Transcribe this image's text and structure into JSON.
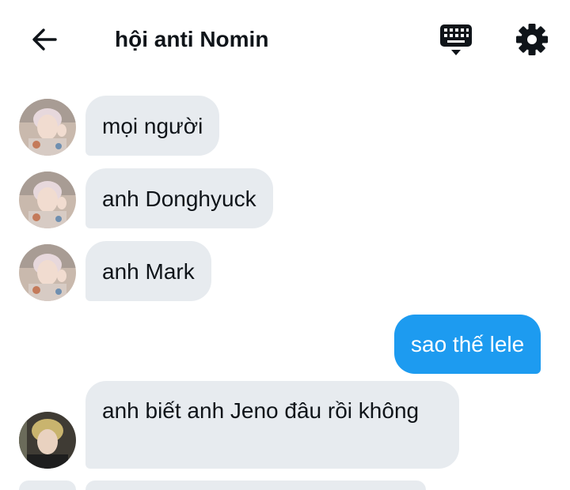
{
  "header": {
    "title": "hội anti Nomin",
    "back_icon": "arrow-left-icon",
    "keyboard_icon": "keyboard-icon",
    "settings_icon": "gear-icon"
  },
  "messages": [
    {
      "sender": "other",
      "text": "mọi người"
    },
    {
      "sender": "other",
      "text": "anh Donghyuck"
    },
    {
      "sender": "other",
      "text": "anh Mark"
    },
    {
      "sender": "self",
      "text": "sao thế lele"
    },
    {
      "sender": "other",
      "text": "anh biết anh Jeno đâu rồi không"
    }
  ],
  "colors": {
    "incoming_bubble": "#e7ebef",
    "outgoing_bubble": "#1d9bf0",
    "text": "#0f1419"
  }
}
